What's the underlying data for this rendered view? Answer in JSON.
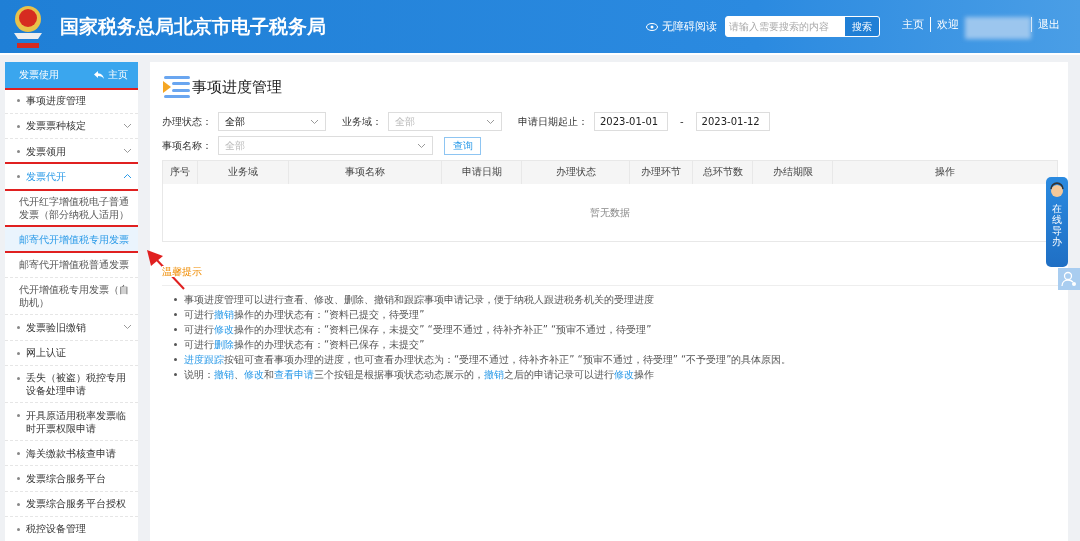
{
  "header": {
    "title": "国家税务总局北京市电子税务局",
    "accessibility": "无障碍阅读",
    "search": {
      "placeholder": "请输入需要搜索的内容",
      "button": "搜索"
    },
    "links": [
      {
        "label": "主页"
      },
      {
        "label": "欢迎"
      },
      {
        "label": "退出"
      }
    ]
  },
  "sidebar": {
    "title": "发票使用",
    "home": "主页",
    "highlighted": true,
    "items": [
      {
        "label": "事项进度管理",
        "expandable": false,
        "expanded": false,
        "highlighted": false
      },
      {
        "label": "发票票种核定",
        "expandable": true,
        "expanded": false,
        "highlighted": false
      },
      {
        "label": "发票领用",
        "expandable": true,
        "expanded": false,
        "highlighted": false
      },
      {
        "label": "发票代开",
        "expandable": true,
        "expanded": true,
        "highlighted": true,
        "children": [
          {
            "label": "代开红字增值税电子普通发票（部分纳税人适用）",
            "selected": false,
            "highlighted": false
          },
          {
            "label": "邮寄代开增值税专用发票",
            "selected": true,
            "highlighted": true
          },
          {
            "label": "邮寄代开增值税普通发票",
            "selected": false,
            "highlighted": false
          },
          {
            "label": "代开增值税专用发票（自助机）",
            "selected": false,
            "highlighted": false
          }
        ]
      },
      {
        "label": "发票验旧缴销",
        "expandable": true,
        "expanded": false,
        "highlighted": false
      },
      {
        "label": "网上认证",
        "expandable": false,
        "expanded": false,
        "highlighted": false
      },
      {
        "label": "丢失（被盗）税控专用设备处理申请",
        "expandable": false,
        "expanded": false,
        "highlighted": false
      },
      {
        "label": "开具原适用税率发票临时开票权限申请",
        "expandable": false,
        "expanded": false,
        "highlighted": false
      },
      {
        "label": "海关缴款书核查申请",
        "expandable": false,
        "expanded": false,
        "highlighted": false
      },
      {
        "label": "发票综合服务平台",
        "expandable": false,
        "expanded": false,
        "highlighted": false
      },
      {
        "label": "发票综合服务平台授权",
        "expandable": false,
        "expanded": false,
        "highlighted": false
      },
      {
        "label": "税控设备管理",
        "expandable": false,
        "expanded": false,
        "highlighted": false
      }
    ]
  },
  "main": {
    "title": "事项进度管理",
    "filters": [
      {
        "label": "办理状态：",
        "kind": "select",
        "value": "全部"
      },
      {
        "label": "业务域：",
        "kind": "select",
        "placeholder": "全部"
      },
      {
        "label": "申请日期起止：",
        "kind": "daterange",
        "from": "2023-01-01",
        "separator": "-",
        "to": "2023-01-12"
      },
      {
        "label": "事项名称：",
        "kind": "select",
        "placeholder": "全部"
      }
    ],
    "query_button": "查询",
    "table": {
      "columns": [
        "序号",
        "业务域",
        "事项名称",
        "申请日期",
        "办理状态",
        "办理环节",
        "总环节数",
        "办结期限",
        "操作"
      ],
      "empty": "暂无数据"
    },
    "tips": {
      "title": "温馨提示",
      "items": [
        [
          {
            "text": "事项进度管理可以进行查看、修改、删除、撤销和跟踪事项申请记录，便于纳税人跟进税务机关的受理进度",
            "kind": "text"
          }
        ],
        [
          {
            "text": "可进行",
            "kind": "text"
          },
          {
            "text": "撤销",
            "kind": "link"
          },
          {
            "text": "操作的办理状态有：“资料已提交，待受理”",
            "kind": "text"
          }
        ],
        [
          {
            "text": "可进行",
            "kind": "text"
          },
          {
            "text": "修改",
            "kind": "link"
          },
          {
            "text": "操作的办理状态有：“资料已保存，未提交” “受理不通过，待补齐补正” “预审不通过，待受理”",
            "kind": "text"
          }
        ],
        [
          {
            "text": "可进行",
            "kind": "text"
          },
          {
            "text": "删除",
            "kind": "link"
          },
          {
            "text": "操作的办理状态有：“资料已保存，未提交”",
            "kind": "text"
          }
        ],
        [
          {
            "text": "进度跟踪",
            "kind": "link"
          },
          {
            "text": "按钮可查看事项办理的进度，也可查看办理状态为：“受理不通过，待补齐补正” “预审不通过，待受理” “不予受理”的具体原因。",
            "kind": "text"
          }
        ],
        [
          {
            "text": "说明：",
            "kind": "text"
          },
          {
            "text": "撤销",
            "kind": "link"
          },
          {
            "text": "、",
            "kind": "text"
          },
          {
            "text": "修改",
            "kind": "link"
          },
          {
            "text": "和",
            "kind": "text"
          },
          {
            "text": "查看申请",
            "kind": "link"
          },
          {
            "text": "三个按钮是根据事项状态动态展示的，",
            "kind": "text"
          },
          {
            "text": "撤销",
            "kind": "link"
          },
          {
            "text": "之后的申请记录可以进行",
            "kind": "text"
          },
          {
            "text": "修改",
            "kind": "link"
          },
          {
            "text": "操作",
            "kind": "text"
          }
        ]
      ]
    }
  },
  "float_widget": {
    "label": "在线导办"
  },
  "annotation": {
    "arrow": true
  }
}
